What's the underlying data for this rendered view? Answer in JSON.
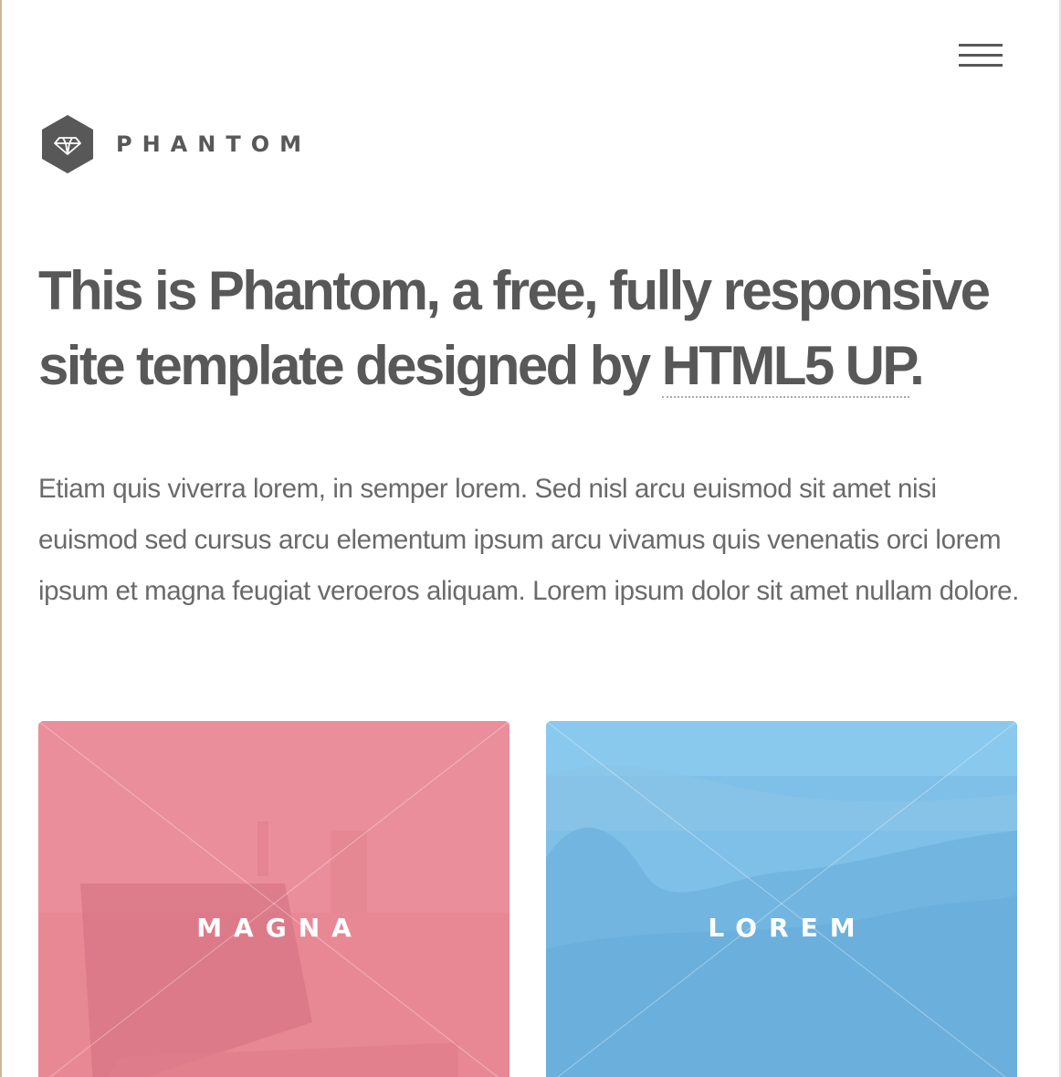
{
  "site": {
    "brand": "PHANTOM",
    "menu_icon": "hamburger-icon",
    "logo_icon": "diamond-icon"
  },
  "headline": {
    "text_before_link": "This is Phantom, a free, fully responsive site template designed by ",
    "link_text": "HTML5 UP",
    "text_after_link": "."
  },
  "intro": "Etiam quis viverra lorem, in semper lorem. Sed nisl arcu euismod sit amet nisi euismod sed cursus arcu elementum ipsum arcu vivamus quis venenatis orci lorem ipsum et magna feugiat veroeros aliquam. Lorem ipsum dolor sit amet nullam dolore.",
  "tiles": [
    {
      "label": "MAGNA",
      "color": "#e98895"
    },
    {
      "label": "LOREM",
      "color": "#7fc0e8"
    }
  ],
  "colors": {
    "text": "#585858",
    "body_text": "#6a6a6a",
    "background": "#ffffff",
    "left_edge": "#c8b89a"
  }
}
